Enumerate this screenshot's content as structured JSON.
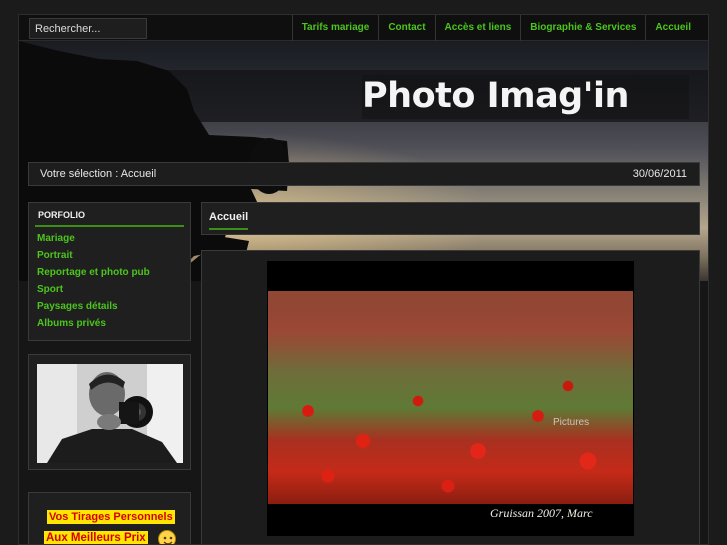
{
  "search": {
    "placeholder": "Rechercher..."
  },
  "nav": {
    "items": [
      "Tarifs mariage",
      "Contact",
      "Accès et liens",
      "Biographie & Services",
      "Accueil"
    ]
  },
  "header": {
    "logo_text": "Photo Imag'in"
  },
  "selection_bar": {
    "label": "Votre sélection : Accueil",
    "date": "30/06/2011"
  },
  "sidebar": {
    "portfolio_title": "PORFOLIO",
    "items": [
      "Mariage",
      "Portrait",
      "Reportage et photo pub",
      "Sport",
      "Paysages détails",
      "Albums privés"
    ]
  },
  "promo": {
    "line1": "Vos Tirages Personnels",
    "line2": "Aux Meilleurs Prix"
  },
  "main": {
    "title": "Accueil",
    "slideshow_label": "Pictures",
    "photo_signature": "Gruissan 2007, Marc"
  },
  "colors": {
    "accent_green": "#4cc51d",
    "underline_green": "#3a8f16",
    "promo_yellow": "#ffe600",
    "promo_red": "#d40000"
  }
}
